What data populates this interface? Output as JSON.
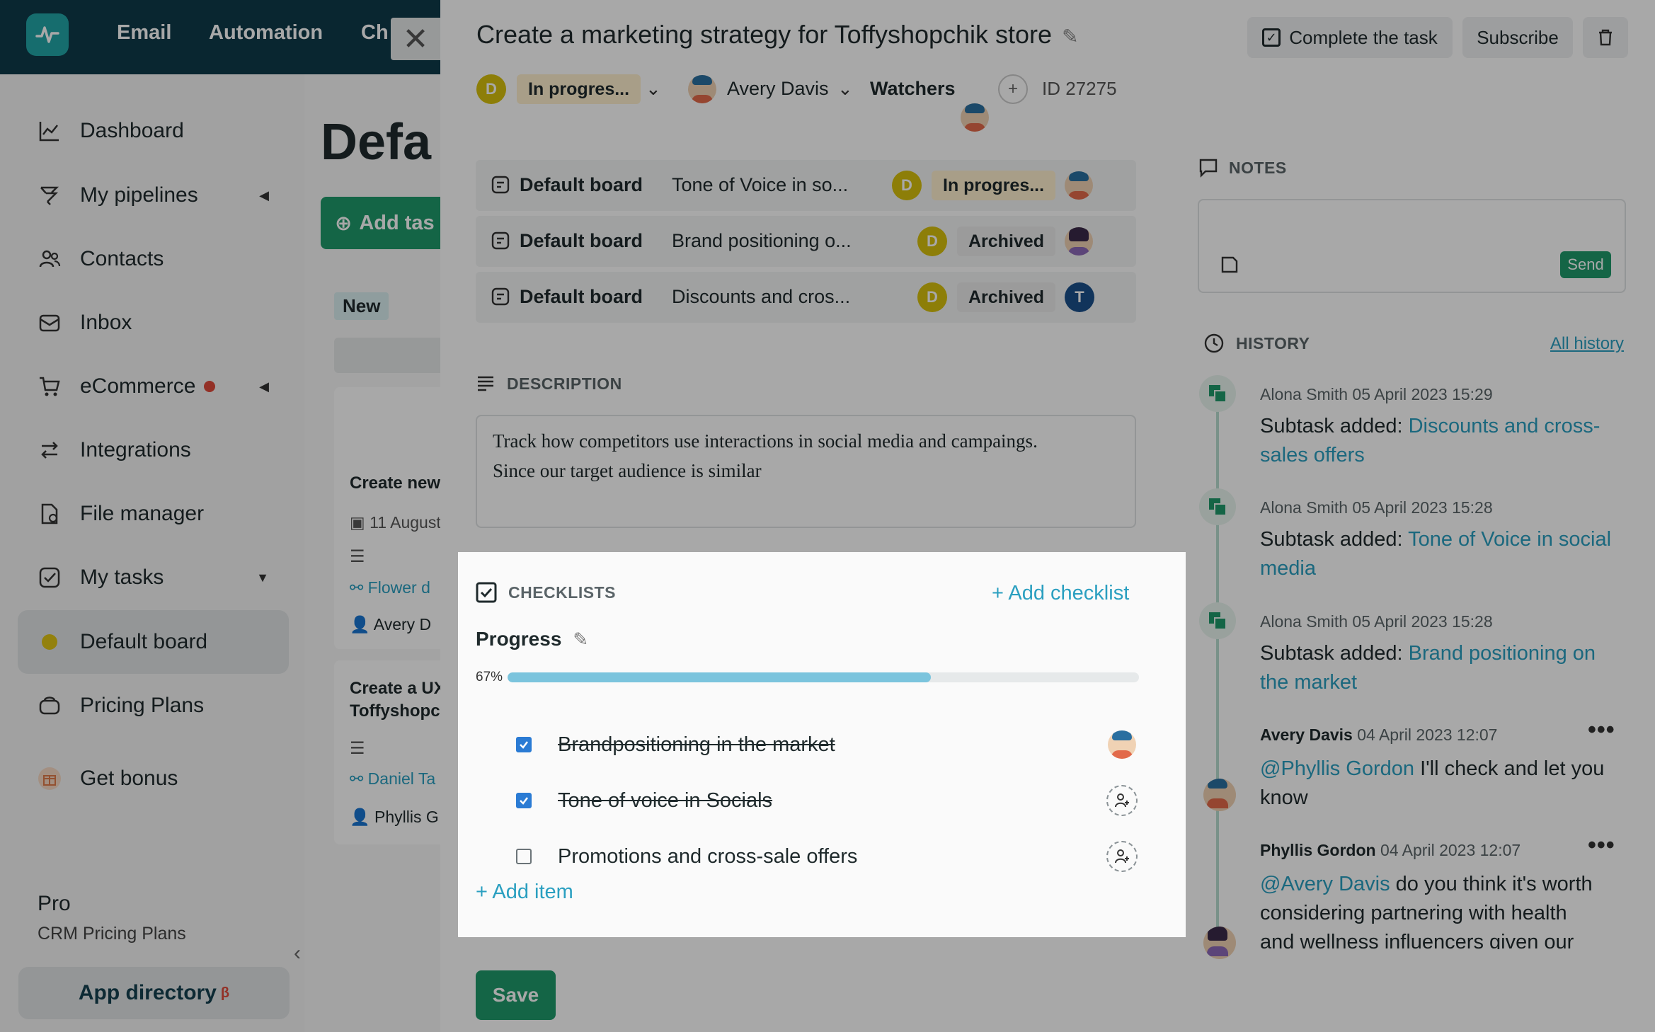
{
  "app": {
    "topnav": [
      "Email",
      "Automation",
      "Ch"
    ],
    "sidebar": [
      {
        "label": "Dashboard",
        "icon": "chart-line-icon"
      },
      {
        "label": "My pipelines",
        "icon": "funnel-icon"
      },
      {
        "label": "Contacts",
        "icon": "contacts-icon"
      },
      {
        "label": "Inbox",
        "icon": "inbox-icon"
      },
      {
        "label": "eCommerce",
        "icon": "cart-icon"
      },
      {
        "label": "Integrations",
        "icon": "integrations-icon"
      },
      {
        "label": "File manager",
        "icon": "file-icon"
      },
      {
        "label": "My tasks",
        "icon": "tasks-icon"
      },
      {
        "label": "Default board",
        "icon": "board-dot-icon"
      },
      {
        "label": "Pricing Plans",
        "icon": "pricing-icon"
      },
      {
        "label": "Get bonus",
        "icon": "gift-icon"
      }
    ],
    "plan_name": "Pro",
    "plan_sub": "CRM Pricing Plans",
    "app_directory": "App directory",
    "app_directory_badge": "β",
    "board_title_partial": "Defa",
    "add_task_partial": "Add tas",
    "column_new": "New",
    "card1_title": "Create new",
    "card1_date": "11 August",
    "card1_link": "Flower d",
    "card1_user": "Avery D",
    "card2_title_l1": "Create a UX",
    "card2_title_l2": "Toffyshopcl",
    "card2_link": "Daniel Ta",
    "card2_user": "Phyllis G"
  },
  "task": {
    "title": "Create a marketing strategy for Toffyshopchik store",
    "complete_label": "Complete the task",
    "subscribe_label": "Subscribe",
    "status": "In progres...",
    "assignee": "Avery Davis",
    "watchers_label": "Watchers",
    "id_label": "ID 27275",
    "avatar_letter": "D"
  },
  "subtasks": [
    {
      "board": "Default board",
      "name": "Tone of Voice in so...",
      "status": "In progres...",
      "avatar": "face"
    },
    {
      "board": "Default board",
      "name": "Brand positioning o...",
      "status": "Archived",
      "avatar": "face-purple"
    },
    {
      "board": "Default board",
      "name": "Discounts and cros...",
      "status": "Archived",
      "avatar": "T"
    }
  ],
  "description": {
    "label": "DESCRIPTION",
    "text_l1": "Track how competitors use interactions in social media and campaings.",
    "text_l2": "Since our target audience is similar"
  },
  "checklists": {
    "label": "CHECKLISTS",
    "add_checklist": "+ Add checklist",
    "name": "Progress",
    "percent_label": "67%",
    "progress": 0.67,
    "items": [
      {
        "text": "Brandpositioning in the market",
        "done": true
      },
      {
        "text": "Tone of voice in Socials",
        "done": true
      },
      {
        "text": "Promotions and cross-sale offers",
        "done": false
      }
    ],
    "add_item": "+ Add item"
  },
  "notes": {
    "label": "NOTES",
    "send_label": "Send"
  },
  "history": {
    "label": "HISTORY",
    "all_history": "All history",
    "entries": [
      {
        "author": "Alona Smith",
        "time": "05 April 2023 15:29",
        "prefix": "Subtask added: ",
        "link_l1": "Discounts and cross-",
        "link_l2": "sales offers"
      },
      {
        "author": "Alona Smith",
        "time": "05 April 2023 15:28",
        "prefix": "Subtask added: ",
        "link_l1": "Tone of Voice in social",
        "link_l2": "media"
      },
      {
        "author": "Alona Smith",
        "time": "05 April 2023 15:28",
        "prefix": "Subtask added: ",
        "link_l1": "Brand positioning on",
        "link_l2": "the market"
      }
    ],
    "comments": [
      {
        "author": "Avery Davis",
        "time": "04 April 2023 12:07",
        "mention": "@Phyllis Gordon",
        "text_l1": " I'll check and let you",
        "text_l2": "know"
      },
      {
        "author": "Phyllis Gordon",
        "time": "04 April 2023 12:07",
        "mention": "@Avery Davis",
        "text_l1": " do you think it's worth",
        "text_l2": "considering partnering with health",
        "text_l3": "and wellness influencers given our"
      }
    ]
  },
  "save_label": "Save",
  "colors": {
    "accent_green": "#1f9a6b",
    "link_blue": "#2a9fc0",
    "dark_nav": "#0f3a4a"
  }
}
